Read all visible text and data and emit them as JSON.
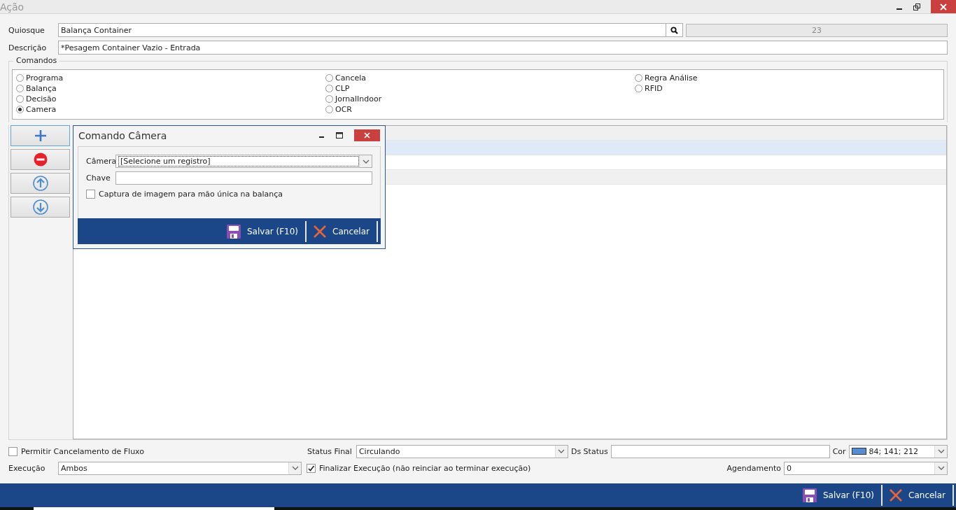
{
  "window": {
    "title": "Ação"
  },
  "form": {
    "quiosque_label": "Quiosque",
    "quiosque_value": "Balança Container",
    "quiosque_code": "23",
    "descricao_label": "Descrição",
    "descricao_value": "*Pesagem Container Vazio - Entrada"
  },
  "comandos": {
    "title": "Comandos",
    "columns": [
      [
        {
          "label": "Programa",
          "selected": false
        },
        {
          "label": "Balança",
          "selected": false
        },
        {
          "label": "Decisão",
          "selected": false
        },
        {
          "label": "Camera",
          "selected": true
        }
      ],
      [
        {
          "label": "Cancela",
          "selected": false
        },
        {
          "label": "CLP",
          "selected": false
        },
        {
          "label": "JornalIndoor",
          "selected": false
        },
        {
          "label": "OCR",
          "selected": false
        }
      ],
      [
        {
          "label": "Regra Análise",
          "selected": false
        },
        {
          "label": "RFID",
          "selected": false
        }
      ]
    ]
  },
  "grid": {
    "rows": [
      {
        "selected": false
      },
      {
        "selected": true
      },
      {
        "selected": false
      },
      {
        "selected": false
      }
    ]
  },
  "dialog": {
    "title": "Comando Câmera",
    "camera_label": "Câmera",
    "camera_value": "[Selecione um registro]",
    "chave_label": "Chave",
    "capture": {
      "label": "Captura de imagem para mão única na balança",
      "checked": false
    },
    "save": "Salvar (F10)",
    "cancel": "Cancelar"
  },
  "bottom": {
    "permitir": {
      "label": "Permitir Cancelamento de Fluxo",
      "checked": false
    },
    "status_label": "Status Final",
    "status_value": "Circulando",
    "ds_status_label": "Ds Status",
    "cor_label": "Cor",
    "cor_value": "84; 141; 212",
    "execucao_label": "Execução",
    "execucao_value": "Ambos",
    "finalizar": {
      "label": "Finalizar Execução (não reinciar ao terminar execução)",
      "checked": true
    },
    "agendamento_label": "Agendamento",
    "agendamento_value": "0"
  },
  "footer": {
    "save": "Salvar (F10)",
    "cancel": "Cancelar"
  }
}
